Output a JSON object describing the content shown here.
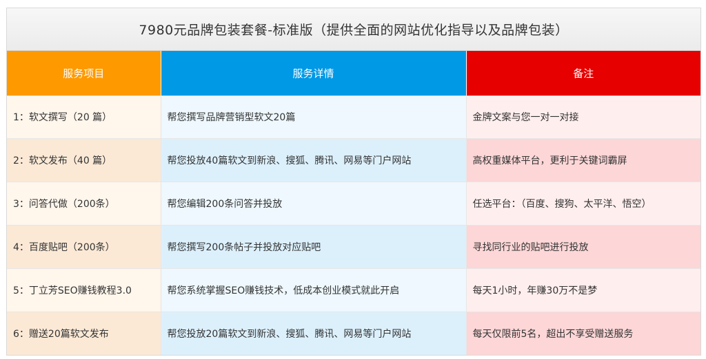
{
  "title": "7980元品牌包装套餐-标准版（提供全面的网站优化指导以及品牌包装）",
  "headers": [
    "服务项目",
    "服务详情",
    "备注"
  ],
  "header_colors": [
    "#ff9900",
    "#0099e6",
    "#e60000"
  ],
  "rows": [
    {
      "item": "1：软文撰写（20 篇）",
      "detail": "帮您撰写品牌营销型软文20篇",
      "note": "金牌文案与您一对一对接"
    },
    {
      "item": "2：软文发布（40 篇）",
      "detail": "帮您投放40篇软文到新浪、搜狐、腾讯、网易等门户网站",
      "note": "高权重媒体平台，更利于关键词霸屏"
    },
    {
      "item": "3：问答代做（200条）",
      "detail": "帮您编辑200条问答并投放",
      "note": "任选平台：（百度、搜狗、太平洋、悟空）"
    },
    {
      "item": "4：百度贴吧（200条）",
      "detail": "帮您撰写200条帖子并投放对应贴吧",
      "note": "寻找同行业的贴吧进行投放"
    },
    {
      "item": "5：丁立芳SEO赚钱教程3.0",
      "detail": "帮您系统掌握SEO赚钱技术，低成本创业模式就此开启",
      "note": "每天1小时，年赚30万不是梦"
    },
    {
      "item": "6：赠送20篇软文发布",
      "detail": "帮您投放20篇软文到新浪、搜狐、腾讯、网易等门户网站",
      "note": "每天仅限前5名，超出不享受赠送服务"
    }
  ]
}
